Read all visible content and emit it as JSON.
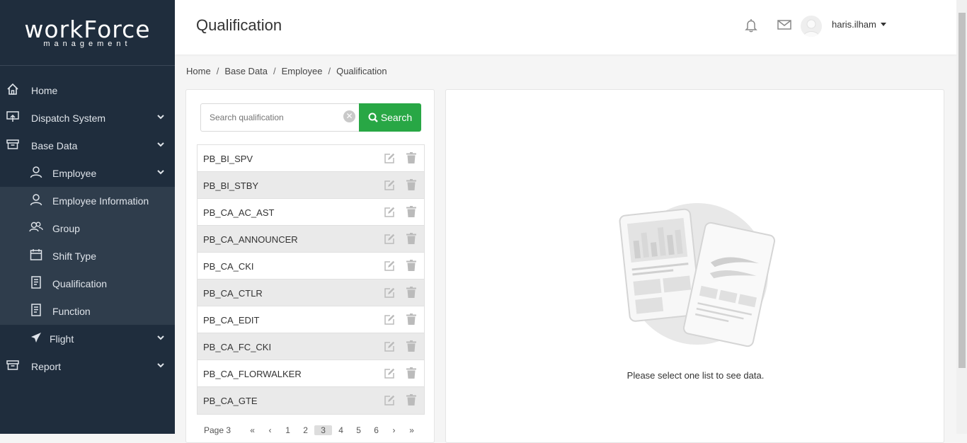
{
  "brand": {
    "name": "workForce",
    "tagline": "management"
  },
  "sidebar": {
    "items": [
      {
        "label": "Home",
        "icon": "home-icon"
      },
      {
        "label": "Dispatch System",
        "icon": "dispatch-icon"
      },
      {
        "label": "Base Data",
        "icon": "archive-icon"
      },
      {
        "label": "Employee",
        "icon": "user-icon"
      },
      {
        "label": "Employee Information",
        "icon": "user-icon"
      },
      {
        "label": "Group",
        "icon": "group-icon"
      },
      {
        "label": "Shift Type",
        "icon": "calendar-icon"
      },
      {
        "label": "Qualification",
        "icon": "document-icon"
      },
      {
        "label": "Function",
        "icon": "document-icon"
      },
      {
        "label": "Flight",
        "icon": "plane-icon"
      },
      {
        "label": "Report",
        "icon": "archive-icon"
      }
    ]
  },
  "header": {
    "title": "Qualification",
    "username": "haris.ilham"
  },
  "breadcrumb": [
    "Home",
    "Base Data",
    "Employee",
    "Qualification"
  ],
  "search": {
    "placeholder": "Search qualification",
    "button_label": "Search"
  },
  "qualifications": [
    "PB_BI_SPV",
    "PB_BI_STBY",
    "PB_CA_AC_AST",
    "PB_CA_ANNOUNCER",
    "PB_CA_CKI",
    "PB_CA_CTLR",
    "PB_CA_EDIT",
    "PB_CA_FC_CKI",
    "PB_CA_FLORWALKER",
    "PB_CA_GTE"
  ],
  "pagination": {
    "label": "Page 3",
    "pages": [
      "1",
      "2",
      "3",
      "4",
      "5",
      "6"
    ],
    "current": "3"
  },
  "detail": {
    "empty_message": "Please select one list to see data."
  },
  "colors": {
    "sidebar_bg": "#1f2d3d",
    "accent_green": "#28a745"
  }
}
